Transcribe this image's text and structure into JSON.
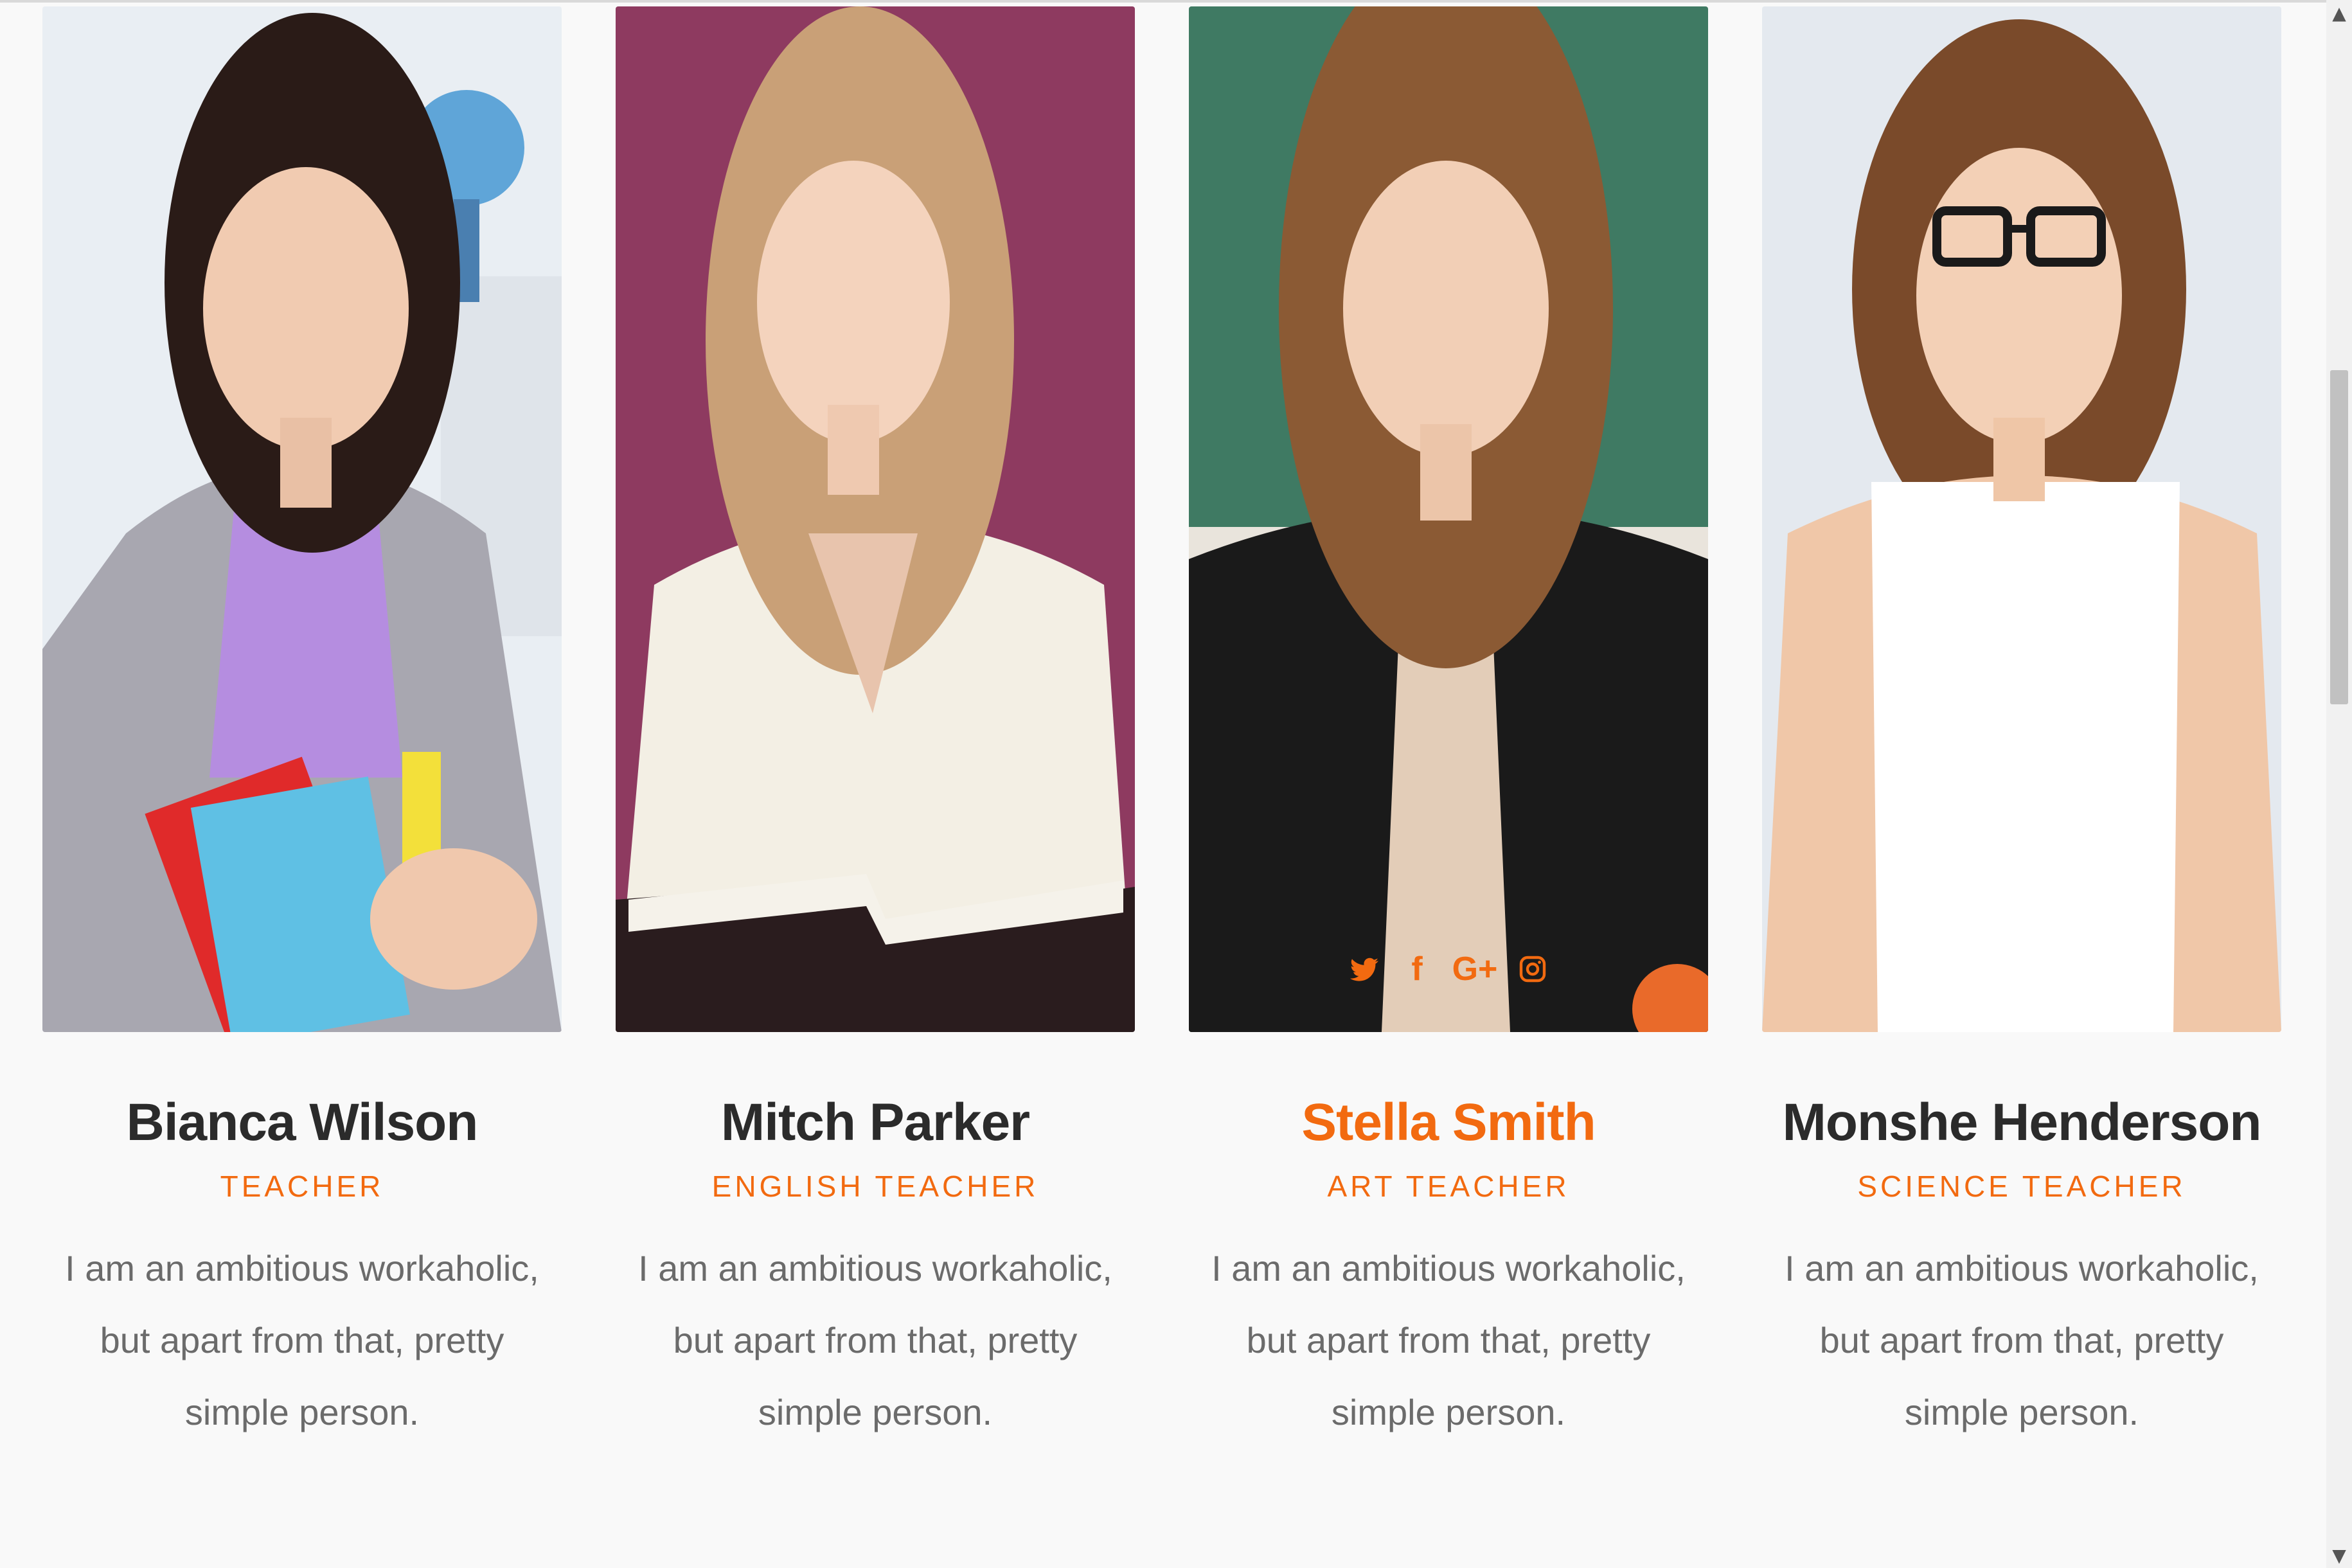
{
  "teachers": [
    {
      "name": "Bianca Wilson",
      "role": "TEACHER",
      "bio": "I am an ambitious workaholic, but apart from that, pretty simple person.",
      "photo_icon": "teacher-photo-icon"
    },
    {
      "name": "Mitch Parker",
      "role": "ENGLISH TEACHER",
      "bio": "I am an ambitious workaholic, but apart from that, pretty simple person.",
      "photo_icon": "teacher-photo-icon"
    },
    {
      "name": "Stella Smith",
      "role": "ART TEACHER",
      "bio": "I am an ambitious workaholic, but apart from that, pretty simple person.",
      "photo_icon": "teacher-photo-icon",
      "social": {
        "twitter_icon": "twitter-icon",
        "facebook_label": "f",
        "googleplus_label": "G+",
        "instagram_icon": "instagram-icon"
      }
    },
    {
      "name": "Monshe Henderson",
      "role": "SCIENCE TEACHER",
      "bio": "I am an ambitious workaholic, but apart from that, pretty simple person.",
      "photo_icon": "teacher-photo-icon"
    }
  ],
  "colors": {
    "accent": "#f26a10",
    "name_text": "#2b2b2b",
    "bio_text": "#6b6b6b",
    "background": "#f9f9f9"
  },
  "scrollbar": {
    "up_arrow": "▲",
    "down_arrow": "▼"
  }
}
